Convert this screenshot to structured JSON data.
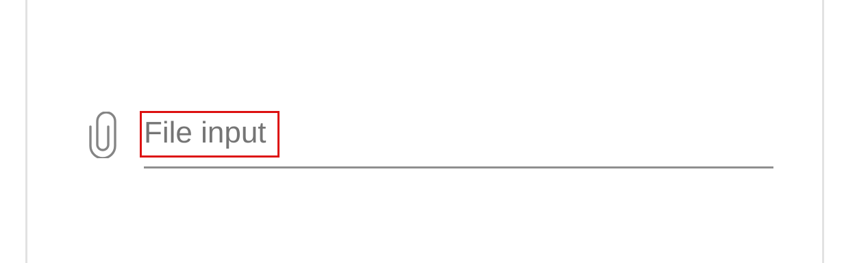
{
  "file_field": {
    "label": "File input",
    "icon": "paperclip-icon"
  },
  "colors": {
    "highlight": "#dd1111",
    "text": "#757575",
    "underline": "#8f8f8f",
    "card_border": "#e2e2e2"
  }
}
